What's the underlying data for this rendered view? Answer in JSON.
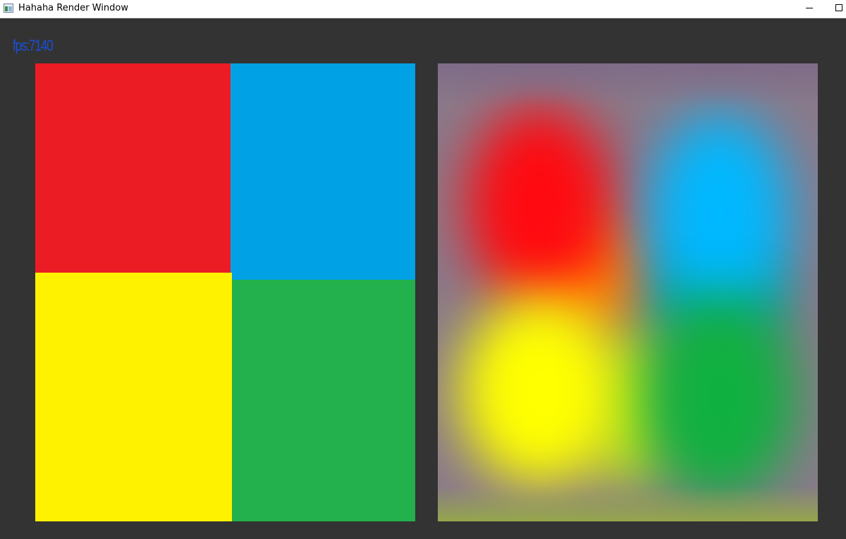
{
  "window": {
    "title": "Hahaha Render Window",
    "icon": "app-window-icon",
    "controls": {
      "minimize_icon": "minimize-icon",
      "maximize_icon": "maximize-icon"
    }
  },
  "overlay": {
    "fps_text": "fps:7140",
    "fps_color": "#1a4fd8"
  },
  "colors": {
    "background": "#333333",
    "red": "#ec1c24",
    "blue": "#00a1e5",
    "yellow": "#fef200",
    "green": "#22b14c"
  },
  "panels": {
    "left": {
      "quadrants": [
        {
          "name": "red",
          "color": "#ec1c24"
        },
        {
          "name": "blue",
          "color": "#00a1e5"
        },
        {
          "name": "yellow",
          "color": "#fef200"
        },
        {
          "name": "green",
          "color": "#22b14c"
        }
      ]
    },
    "right": {
      "effect": "blurred",
      "blob_colors": {
        "red": "#ff0a10",
        "blue": "#00b8ff",
        "yellow": "#ffff00",
        "green": "#10b040",
        "orange": "#ff8a00",
        "teal": "#00a090",
        "lime": "#b8e020"
      }
    }
  }
}
